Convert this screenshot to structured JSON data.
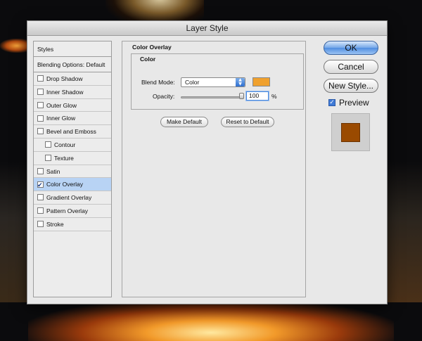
{
  "dialog": {
    "title": "Layer Style"
  },
  "style_list": {
    "header_styles": "Styles",
    "header_blending": "Blending Options: Default",
    "items": [
      {
        "label": "Drop Shadow",
        "checked": false,
        "indent": false,
        "selected": false
      },
      {
        "label": "Inner Shadow",
        "checked": false,
        "indent": false,
        "selected": false
      },
      {
        "label": "Outer Glow",
        "checked": false,
        "indent": false,
        "selected": false
      },
      {
        "label": "Inner Glow",
        "checked": false,
        "indent": false,
        "selected": false
      },
      {
        "label": "Bevel and Emboss",
        "checked": false,
        "indent": false,
        "selected": false
      },
      {
        "label": "Contour",
        "checked": false,
        "indent": true,
        "selected": false
      },
      {
        "label": "Texture",
        "checked": false,
        "indent": true,
        "selected": false
      },
      {
        "label": "Satin",
        "checked": false,
        "indent": false,
        "selected": false
      },
      {
        "label": "Color Overlay",
        "checked": true,
        "indent": false,
        "selected": true
      },
      {
        "label": "Gradient Overlay",
        "checked": false,
        "indent": false,
        "selected": false
      },
      {
        "label": "Pattern Overlay",
        "checked": false,
        "indent": false,
        "selected": false
      },
      {
        "label": "Stroke",
        "checked": false,
        "indent": false,
        "selected": false
      }
    ]
  },
  "panel": {
    "title": "Color Overlay",
    "group_title": "Color",
    "blend_mode_label": "Blend Mode:",
    "blend_mode_value": "Color",
    "overlay_color": "#f0a12e",
    "opacity_label": "Opacity:",
    "opacity_value": "100",
    "opacity_unit": "%",
    "opacity_fraction": 1.0,
    "make_default_label": "Make Default",
    "reset_default_label": "Reset to Default"
  },
  "actions": {
    "ok_label": "OK",
    "cancel_label": "Cancel",
    "new_style_label": "New Style...",
    "preview_label": "Preview",
    "preview_checked": true,
    "preview_swatch_color": "#9a4a00"
  },
  "colors": {
    "selected_row": "#b8d3f4",
    "dialog_bg": "#e8e8e8"
  }
}
